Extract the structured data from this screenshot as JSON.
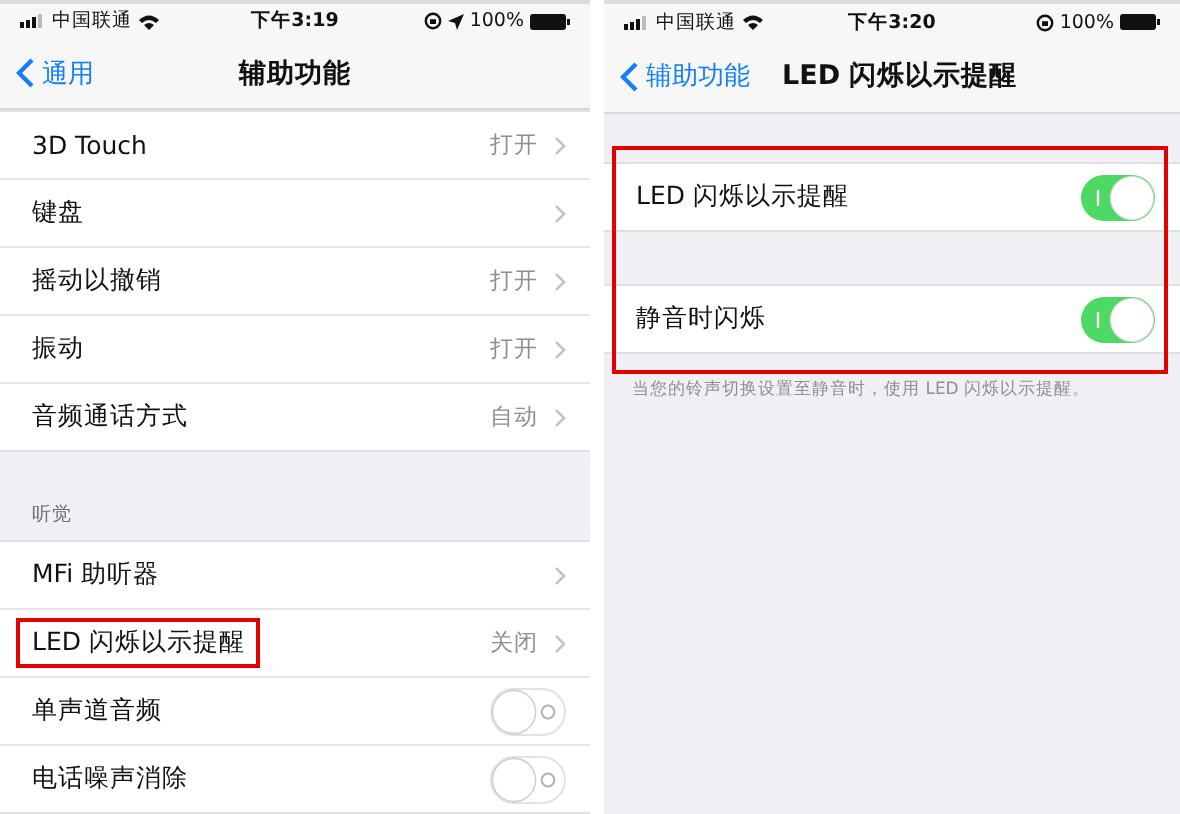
{
  "screens": [
    {
      "status": {
        "carrier": "中国联通",
        "time": "下午3:19",
        "location": true,
        "battery": "100%"
      },
      "nav": {
        "back": "通用",
        "title": "辅助功能"
      },
      "top_gap": false,
      "highlight_group": false,
      "sections": [
        {
          "rows": [
            {
              "label": "3D Touch",
              "kind": "link",
              "value": "打开",
              "highlighted": false
            },
            {
              "label": "键盘",
              "kind": "link",
              "highlighted": false
            },
            {
              "label": "摇动以撤销",
              "kind": "link",
              "value": "打开",
              "highlighted": false
            },
            {
              "label": "振动",
              "kind": "link",
              "value": "打开",
              "highlighted": false
            },
            {
              "label": "音频通话方式",
              "kind": "link",
              "value": "自动",
              "highlighted": false
            }
          ]
        },
        {
          "header": "听觉",
          "rows": [
            {
              "label": "MFi 助听器",
              "kind": "link",
              "highlighted": false
            },
            {
              "label": "LED 闪烁以示提醒",
              "kind": "link",
              "value": "关闭",
              "highlighted": true
            },
            {
              "label": "单声道音频",
              "kind": "toggle",
              "on": false,
              "highlighted": false
            },
            {
              "label": "电话噪声消除",
              "kind": "toggle",
              "on": false,
              "highlighted": false
            }
          ]
        }
      ]
    },
    {
      "status": {
        "carrier": "中国联通",
        "time": "下午3:20",
        "location": false,
        "battery": "100%"
      },
      "nav": {
        "back": "辅助功能",
        "title": "LED 闪烁以示提醒"
      },
      "top_gap": true,
      "highlight_group": true,
      "sections": [
        {
          "rows": [
            {
              "label": "LED 闪烁以示提醒",
              "kind": "toggle",
              "on": true,
              "highlighted": false
            }
          ]
        },
        {
          "rows": [
            {
              "label": "静音时闪烁",
              "kind": "toggle",
              "on": true,
              "highlighted": false
            }
          ]
        }
      ],
      "footer": "当您的铃声切换设置至静音时，使用 LED 闪烁以示提醒。"
    }
  ]
}
